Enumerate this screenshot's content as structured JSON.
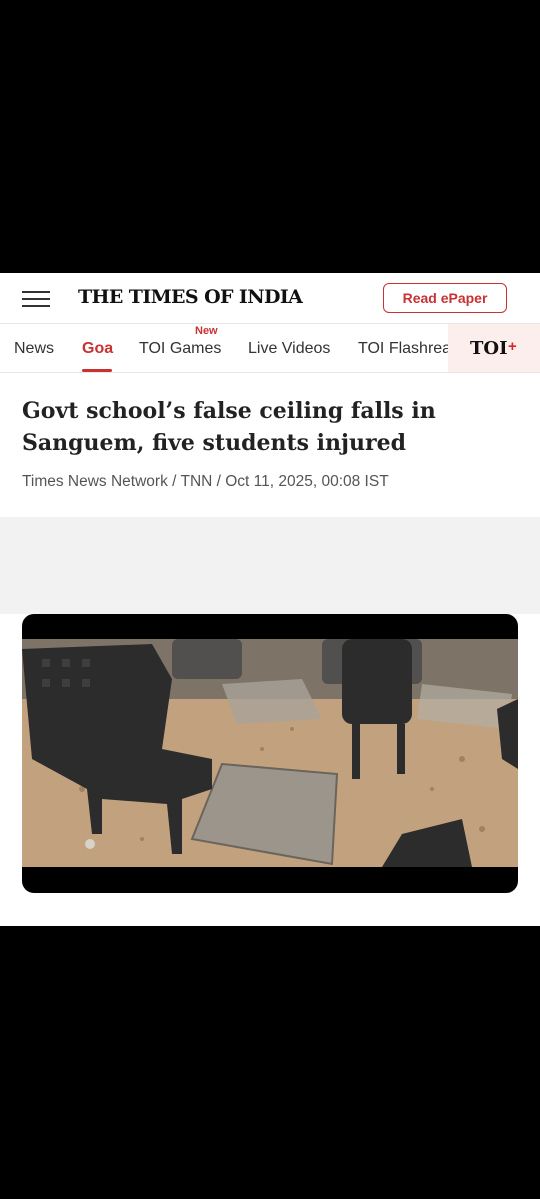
{
  "header": {
    "logo_text": "THE TIMES OF INDIA",
    "read_epaper_label": "Read ePaper"
  },
  "nav": {
    "items": [
      {
        "label": "News",
        "active": false
      },
      {
        "label": "Goa",
        "active": true
      },
      {
        "label": "TOI Games",
        "active": false,
        "badge": "New"
      },
      {
        "label": "Live Videos",
        "active": false
      },
      {
        "label": "TOI Flashreads",
        "active": false
      }
    ],
    "toi_plus": {
      "label": "TOI",
      "plus": "+"
    }
  },
  "article": {
    "headline": "Govt school’s false ceiling falls in Sanguem, five students injured",
    "byline": "Times News Network / TNN / Oct 11, 2025, 00:08 IST"
  },
  "colors": {
    "accent": "#c83232",
    "text": "#222222"
  }
}
